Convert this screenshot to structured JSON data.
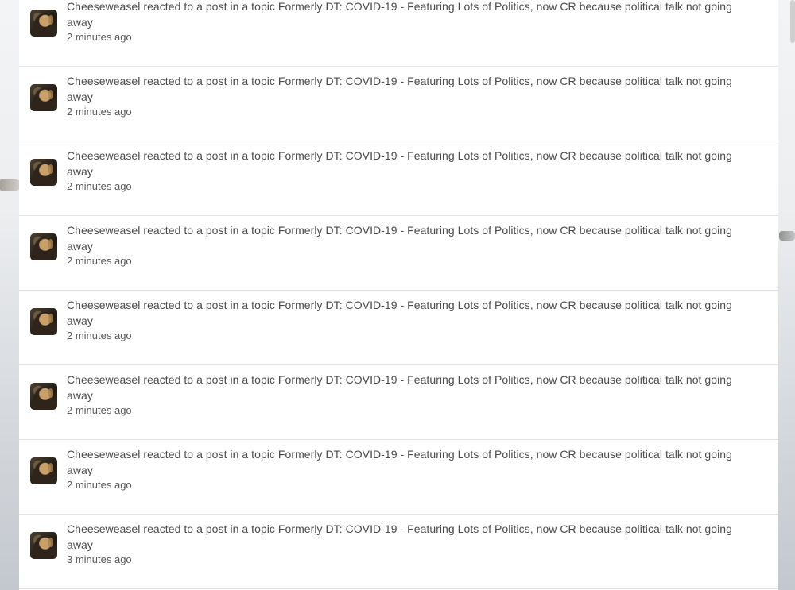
{
  "notifications": [
    {
      "text": "Cheeseweasel reacted to a post in a topic Formerly DT: COVID-19 - Featuring Lots of Politics, now CR because political talk not going away",
      "time": "2 minutes ago"
    },
    {
      "text": "Cheeseweasel reacted to a post in a topic Formerly DT: COVID-19 - Featuring Lots of Politics, now CR because political talk not going away",
      "time": "2 minutes ago"
    },
    {
      "text": "Cheeseweasel reacted to a post in a topic Formerly DT: COVID-19 - Featuring Lots of Politics, now CR because political talk not going away",
      "time": "2 minutes ago"
    },
    {
      "text": "Cheeseweasel reacted to a post in a topic Formerly DT: COVID-19 - Featuring Lots of Politics, now CR because political talk not going away",
      "time": "2 minutes ago"
    },
    {
      "text": "Cheeseweasel reacted to a post in a topic Formerly DT: COVID-19 - Featuring Lots of Politics, now CR because political talk not going away",
      "time": "2 minutes ago"
    },
    {
      "text": "Cheeseweasel reacted to a post in a topic Formerly DT: COVID-19 - Featuring Lots of Politics, now CR because political talk not going away",
      "time": "2 minutes ago"
    },
    {
      "text": "Cheeseweasel reacted to a post in a topic Formerly DT: COVID-19 - Featuring Lots of Politics, now CR because political talk not going away",
      "time": "2 minutes ago"
    },
    {
      "text": "Cheeseweasel reacted to a post in a topic Formerly DT: COVID-19 - Featuring Lots of Politics, now CR because political talk not going away",
      "time": "3 minutes ago"
    }
  ]
}
